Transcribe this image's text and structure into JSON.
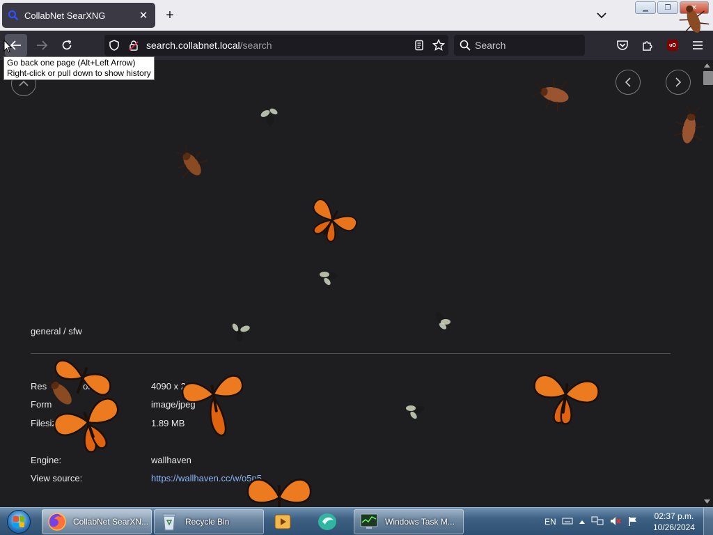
{
  "browser": {
    "tab": {
      "title": "CollabNet SearXNG",
      "close_glyph": "✕"
    },
    "new_tab_glyph": "+",
    "window_buttons": {
      "minimize": "▁",
      "maximize": "❐",
      "close": "✕"
    },
    "url": {
      "host": "search.collabnet.local",
      "path": "/search"
    },
    "search_placeholder": "Search",
    "tooltip": {
      "line1": "Go back one page (Alt+Left Arrow)",
      "line2": "Right-click or pull down to show history"
    }
  },
  "detail": {
    "category": "general / sfw",
    "rows": [
      {
        "key": "Resolution:",
        "value": "4090 x 2",
        "visible_key": "Res",
        "visible_value": "4090 x 2"
      },
      {
        "key": "Format:",
        "value": "image/jpeg"
      },
      {
        "key": "Filesize:",
        "value": "1.89 MB"
      },
      {
        "key": "Engine:",
        "value": "wallhaven"
      },
      {
        "key": "View source:",
        "value": "https://wallhaven.cc/w/o5p5"
      }
    ],
    "labels": {
      "res_prefix": "Res",
      "res_suffix": "on:",
      "format_prefix": "Form",
      "filesize_prefix": "Filesiz",
      "engine": "Engine:",
      "view_source": "View source:"
    },
    "values": {
      "resolution": "4090 x 2",
      "format": "image/jpeg",
      "filesize": "1.89 MB",
      "engine": "wallhaven",
      "source_url": "https://wallhaven.cc/w/o5p5"
    }
  },
  "taskbar": {
    "items": [
      {
        "label": "CollabNet SearXN...",
        "icon": "firefox-icon"
      },
      {
        "label": "Recycle Bin",
        "icon": "recycle-bin-icon"
      },
      {
        "label": "",
        "icon": "media-player-icon"
      },
      {
        "label": "",
        "icon": "app-icon"
      },
      {
        "label": "Windows Task M...",
        "icon": "task-manager-icon"
      }
    ],
    "tray": {
      "lang": "EN"
    },
    "clock": {
      "time": "02:37 p.m.",
      "date": "10/26/2024"
    }
  },
  "colors": {
    "accent": "#8ab4f8",
    "page_bg": "#1e1e20",
    "toolbar_bg": "#2b2a33",
    "butterfly": "#e8741c",
    "cockroach": "#8a4a22"
  }
}
